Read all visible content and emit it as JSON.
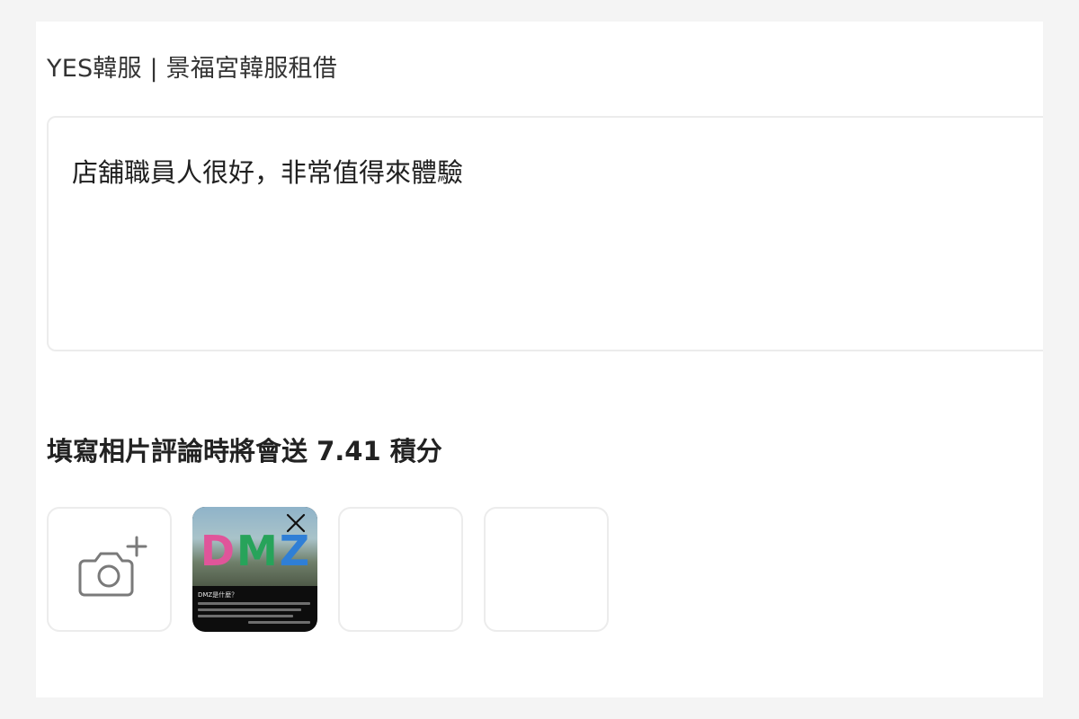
{
  "header": {
    "shop_name": "YES韓服 | 景福宮韓服租借"
  },
  "review": {
    "text": "店舖職員人很好，非常值得來體驗"
  },
  "reward": {
    "title": "填寫相片評論時將會送 7.41 積分"
  },
  "photos": {
    "add_icon": "camera-plus-icon",
    "uploaded": [
      {
        "letters": [
          "D",
          "M",
          "Z"
        ],
        "caption": "DMZ是什麼？",
        "remove_icon": "close-icon"
      }
    ],
    "empty_slots": 2
  },
  "colors": {
    "border": "#ececec",
    "background": "#f4f4f4",
    "icon": "#7a7a7a"
  }
}
